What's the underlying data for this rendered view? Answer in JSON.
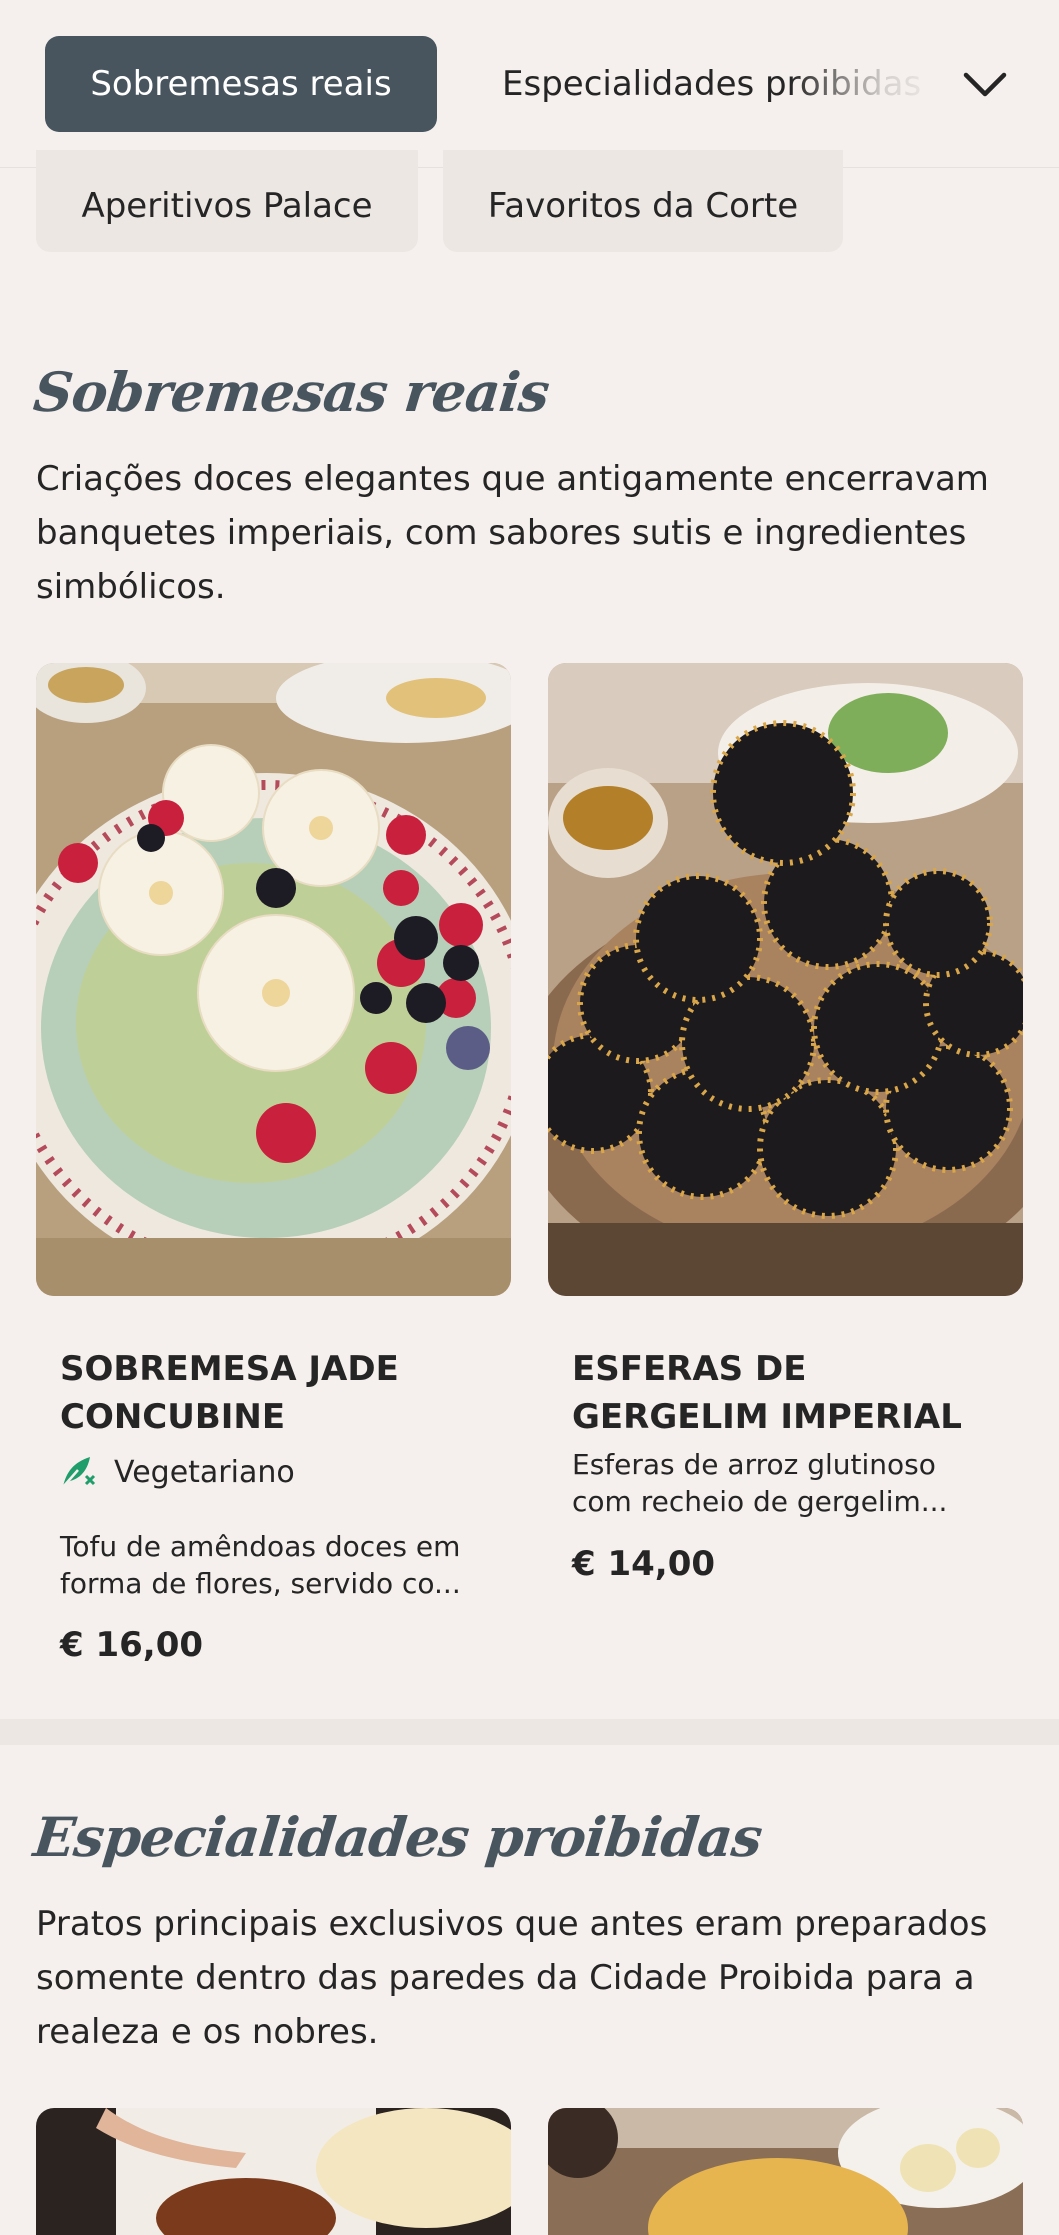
{
  "nav": {
    "active_tab": "Sobremesas reais",
    "next_tab": "Especialidades proibidas",
    "chips": [
      "Aperitivos Palace",
      "Favoritos da Corte"
    ]
  },
  "sections": [
    {
      "title": "Sobremesas reais",
      "description": "Criações doces elegantes que antigamente encerravam banquetes imperiais, com sabores sutis e ingredientes simbólicos.",
      "items": [
        {
          "name": "SOBREMESA JADE CONCUBINE",
          "badge": "Vegetariano",
          "description": "Tofu de amêndoas doces em forma de flores, servido co...",
          "price": "€ 16,00"
        },
        {
          "name": "ESFERAS DE GERGELIM IMPERIAL",
          "description": "Esferas de arroz glutinoso com recheio de gergelim...",
          "price": "€ 14,00"
        }
      ]
    },
    {
      "title": "Especialidades proibidas",
      "description": "Pratos principais exclusivos que antes eram preparados somente dentro das paredes da Cidade Proibida para a realeza e os nobres."
    }
  ],
  "colors": {
    "background": "#f5f0ed",
    "accent": "#48555e",
    "text": "#252525",
    "veg_green": "#1f9d6b"
  },
  "icons": {
    "dropdown": "chevron-down-icon",
    "vegetarian": "vegetarian-leaf-icon"
  }
}
